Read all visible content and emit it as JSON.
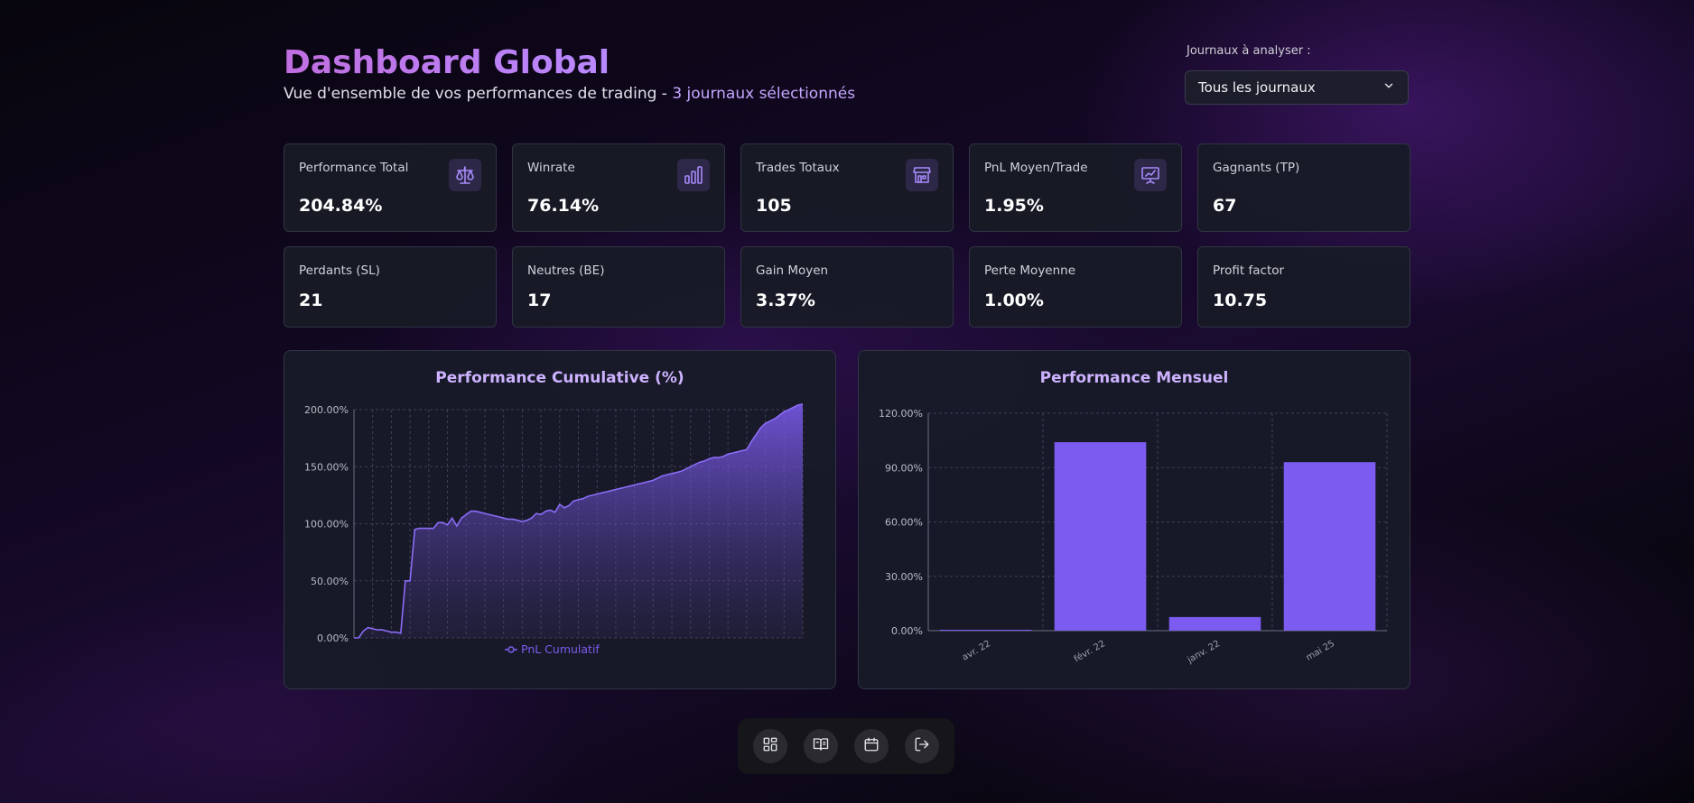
{
  "header": {
    "title": "Dashboard Global",
    "subtitle": "Vue d'ensemble de vos performances de trading - ",
    "subtitle_highlight": "3 journaux sélectionnés"
  },
  "journal_filter": {
    "label": "Journaux à analyser :",
    "selected": "Tous les journaux"
  },
  "stats_row1": [
    {
      "label": "Performance Total",
      "value": "204.84%",
      "icon": "scale-icon"
    },
    {
      "label": "Winrate",
      "value": "76.14%",
      "icon": "bar-chart-icon"
    },
    {
      "label": "Trades Totaux",
      "value": "105",
      "icon": "store-icon"
    },
    {
      "label": "PnL Moyen/Trade",
      "value": "1.95%",
      "icon": "presentation-chart-icon"
    },
    {
      "label": "Gagnants (TP)",
      "value": "67"
    }
  ],
  "stats_row2": [
    {
      "label": "Perdants (SL)",
      "value": "21"
    },
    {
      "label": "Neutres (BE)",
      "value": "17"
    },
    {
      "label": "Gain Moyen",
      "value": "3.37%"
    },
    {
      "label": "Perte Moyenne",
      "value": "1.00%"
    },
    {
      "label": "Profit factor",
      "value": "10.75"
    }
  ],
  "colors": {
    "accent": "#7c5cf0",
    "title_gradient_start": "#c06ee0",
    "title_gradient_end": "#b989ff",
    "chart_title": "#cdb2ff"
  },
  "chart_data": [
    {
      "type": "area",
      "title": "Performance Cumulative (%)",
      "legend": "PnL Cumulatif",
      "legend_position": "bottom",
      "ylim": [
        0,
        200
      ],
      "y_ticks": [
        "0.00%",
        "50.00%",
        "100.00%",
        "150.00%",
        "200.00%"
      ],
      "grid": true,
      "series": [
        {
          "name": "PnL Cumulatif",
          "values": [
            0,
            0,
            6,
            9,
            8,
            7,
            7,
            6,
            5,
            5,
            4,
            50,
            50,
            95,
            96,
            96,
            96,
            96,
            101,
            101,
            99,
            105,
            98,
            105,
            108,
            111,
            111,
            110,
            109,
            108,
            107,
            106,
            105,
            104,
            104,
            103,
            102,
            103,
            105,
            109,
            108,
            111,
            112,
            110,
            117,
            114,
            116,
            120,
            121,
            122,
            124,
            125,
            126,
            127,
            128,
            129,
            130,
            131,
            132,
            133,
            134,
            135,
            136,
            137,
            138,
            140,
            142,
            143,
            144,
            145,
            146,
            148,
            150,
            152,
            154,
            155,
            157,
            158,
            158,
            159,
            161,
            162,
            163,
            164,
            165,
            172,
            178,
            184,
            188,
            190,
            192,
            195,
            198,
            200,
            202,
            204,
            204.84
          ]
        }
      ]
    },
    {
      "type": "bar",
      "title": "Performance Mensuel",
      "categories": [
        "avr. 22",
        "févr. 22",
        "janv. 22",
        "mai 25"
      ],
      "values": [
        0.5,
        104,
        7.5,
        93
      ],
      "ylim": [
        0,
        120
      ],
      "y_ticks": [
        "0.00%",
        "30.00%",
        "60.00%",
        "90.00%",
        "120.00%"
      ],
      "grid": true
    }
  ],
  "dock": [
    {
      "name": "dashboard-icon"
    },
    {
      "name": "journal-book-icon"
    },
    {
      "name": "calendar-icon"
    },
    {
      "name": "logout-icon"
    }
  ]
}
